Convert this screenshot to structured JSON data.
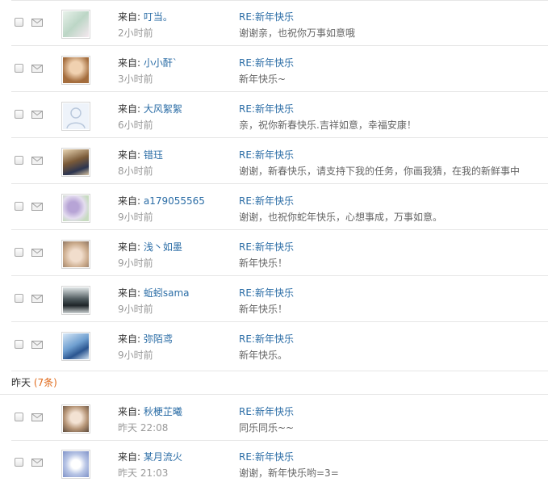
{
  "labels": {
    "from_prefix": "来自:"
  },
  "today_messages": [
    {
      "sender": "叮当。",
      "time": "2小时前",
      "subject": "RE:新年快乐",
      "preview": "谢谢亲，也祝你万事如意哦",
      "avatar_color": "#cfe3d5"
    },
    {
      "sender": "小小酐`",
      "time": "3小时前",
      "subject": "RE:新年快乐",
      "preview": "新年快乐~",
      "avatar_color": "#c79a63"
    },
    {
      "sender": "大风絮絮",
      "time": "6小时前",
      "subject": "RE:新年快乐",
      "preview": "亲，祝你新春快乐.吉祥如意，幸福安康！",
      "avatar_color": "#dfe8f4"
    },
    {
      "sender": "错珏",
      "time": "8小时前",
      "subject": "RE:新年快乐",
      "preview": "谢谢，新春快乐，请支持下我的任务，你画我猜，在我的新鲜事中",
      "avatar_color": "#8b6b45"
    },
    {
      "sender": "a179055565",
      "time": "9小时前",
      "subject": "RE:新年快乐",
      "preview": "谢谢，也祝你蛇年快乐，心想事成，万事如意。",
      "avatar_color": "#c8b9dc"
    },
    {
      "sender": "浅丶如墨",
      "time": "9小时前",
      "subject": "RE:新年快乐",
      "preview": "新年快乐！",
      "avatar_color": "#d9c8b2"
    },
    {
      "sender": "蚯蚓sama",
      "time": "9小时前",
      "subject": "RE:新年快乐",
      "preview": "新年快乐！",
      "avatar_color": "#6d7a7c"
    },
    {
      "sender": "弥陌鸢",
      "time": "9小时前",
      "subject": "RE:新年快乐",
      "preview": "新年快乐。",
      "avatar_color": "#6f9fd0"
    }
  ],
  "yesterday_group": {
    "label": "昨天",
    "count": "(7条)"
  },
  "yesterday_messages": [
    {
      "sender": "秋梗芷曦",
      "time": "昨天 22:08",
      "subject": "RE:新年快乐",
      "preview": "同乐同乐~~",
      "avatar_color": "#b69577"
    },
    {
      "sender": "某月流火",
      "time": "昨天 21:03",
      "subject": "RE:新年快乐",
      "preview": "谢谢，新年快乐哟=3=",
      "avatar_color": "#b9c6e6"
    }
  ],
  "icons": {
    "mail": "envelope-icon"
  }
}
